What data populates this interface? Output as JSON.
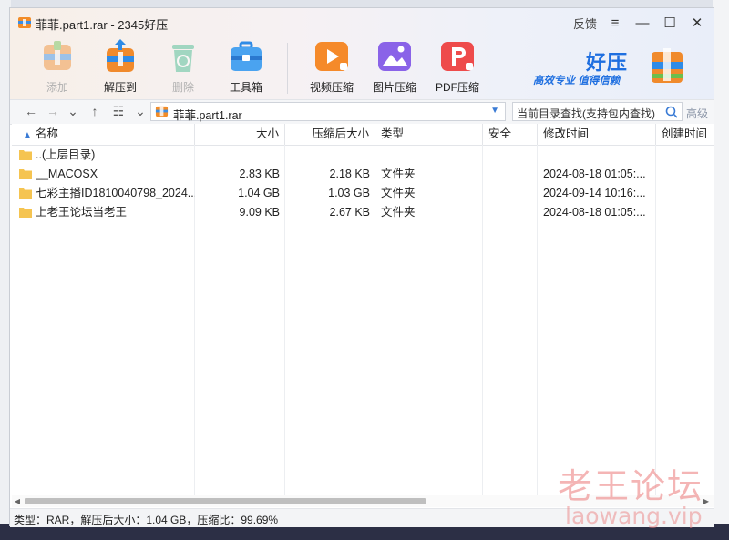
{
  "window": {
    "title": "菲菲.part1.rar - 2345好压",
    "feedback_label": "反馈",
    "menu_icon": "hamburger-icon",
    "minimize_icon": "minimize-icon",
    "maximize_icon": "maximize-icon",
    "close_icon": "close-icon"
  },
  "toolbar": {
    "items": [
      {
        "label": "添加",
        "icon": "add-archive-icon",
        "enabled": false
      },
      {
        "label": "解压到",
        "icon": "extract-icon",
        "enabled": true
      },
      {
        "label": "删除",
        "icon": "recycle-delete-icon",
        "enabled": false
      },
      {
        "label": "工具箱",
        "icon": "toolbox-icon",
        "enabled": true
      },
      {
        "label": "视频压缩",
        "icon": "video-compress-icon",
        "enabled": true
      },
      {
        "label": "图片压缩",
        "icon": "image-compress-icon",
        "enabled": true
      },
      {
        "label": "PDF压缩",
        "icon": "pdf-compress-icon",
        "enabled": true
      }
    ]
  },
  "brand": {
    "name": "好压",
    "slogan": "高效专业  值得信赖"
  },
  "address": {
    "path": "菲菲.part1.rar",
    "search_placeholder": "当前目录查找(支持包内查找)",
    "advanced_label": "高级"
  },
  "columns": [
    "名称",
    "大小",
    "压缩后大小",
    "类型",
    "安全",
    "修改时间",
    "创建时间"
  ],
  "files": [
    {
      "name": "..(上层目录)",
      "size": "",
      "packed": "",
      "type": "",
      "security": "",
      "modified": "",
      "created": ""
    },
    {
      "name": "__MACOSX",
      "size": "2.83 KB",
      "packed": "2.18 KB",
      "type": "文件夹",
      "security": "",
      "modified": "2024-08-18 01:05:...",
      "created": ""
    },
    {
      "name": "七彩主播ID1810040798_2024...",
      "size": "1.04 GB",
      "packed": "1.03 GB",
      "type": "文件夹",
      "security": "",
      "modified": "2024-09-14 10:16:...",
      "created": ""
    },
    {
      "name": "上老王论坛当老王",
      "size": "9.09 KB",
      "packed": "2.67 KB",
      "type": "文件夹",
      "security": "",
      "modified": "2024-08-18 01:05:...",
      "created": ""
    }
  ],
  "status": {
    "text": "类型：RAR，解压后大小：1.04 GB，压缩比：99.69%"
  },
  "watermark": {
    "line1": "老王论坛",
    "line2": "laowang.vip"
  },
  "colors": {
    "accent": "#1f6fe0",
    "folder": "#f5c451",
    "watermark": "#eb7878"
  }
}
